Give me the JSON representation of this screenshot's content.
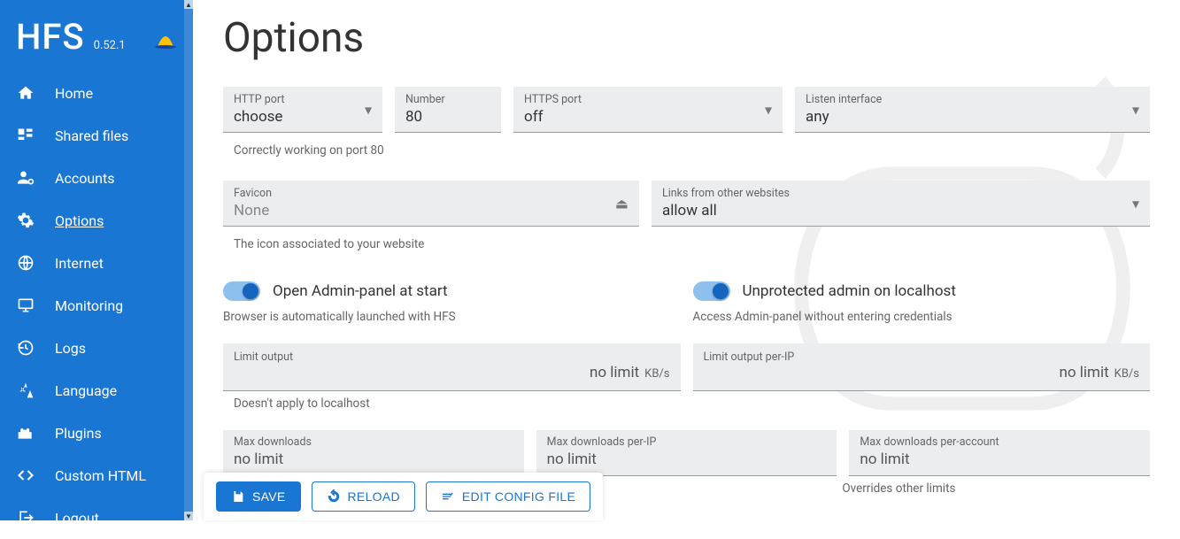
{
  "app": {
    "name": "HFS",
    "version": "0.52.1"
  },
  "sidebar": {
    "items": [
      {
        "label": "Home"
      },
      {
        "label": "Shared files"
      },
      {
        "label": "Accounts"
      },
      {
        "label": "Options"
      },
      {
        "label": "Internet"
      },
      {
        "label": "Monitoring"
      },
      {
        "label": "Logs"
      },
      {
        "label": "Language"
      },
      {
        "label": "Plugins"
      },
      {
        "label": "Custom HTML"
      },
      {
        "label": "Logout"
      }
    ]
  },
  "page": {
    "title": "Options"
  },
  "ports": {
    "http_label": "HTTP port",
    "http_value": "choose",
    "number_label": "Number",
    "number_value": "80",
    "https_label": "HTTPS port",
    "https_value": "off",
    "iface_label": "Listen interface",
    "iface_value": "any",
    "status": "Correctly working on port 80"
  },
  "favicon": {
    "label": "Favicon",
    "value": "None",
    "hint": "The icon associated to your website"
  },
  "links": {
    "label": "Links from other websites",
    "value": "allow all"
  },
  "toggles": {
    "open_admin_label": "Open Admin-panel at start",
    "open_admin_hint": "Browser is automatically launched with HFS",
    "unprotected_label": "Unprotected admin on localhost",
    "unprotected_hint": "Access Admin-panel without entering credentials"
  },
  "limits": {
    "out_label": "Limit output",
    "out_value": "no limit",
    "out_unit": "KB/s",
    "out_hint": "Doesn't apply to localhost",
    "ip_label": "Limit output per-IP",
    "ip_value": "no limit",
    "ip_unit": "KB/s"
  },
  "downloads": {
    "max_label": "Max downloads",
    "max_value": "no limit",
    "perip_label": "Max downloads per-IP",
    "perip_value": "no limit",
    "peracc_label": "Max downloads per-account",
    "peracc_value": "no limit",
    "peracc_hint": "Overrides other limits"
  },
  "actions": {
    "save": "SAVE",
    "reload": "RELOAD",
    "edit": "EDIT CONFIG FILE"
  }
}
